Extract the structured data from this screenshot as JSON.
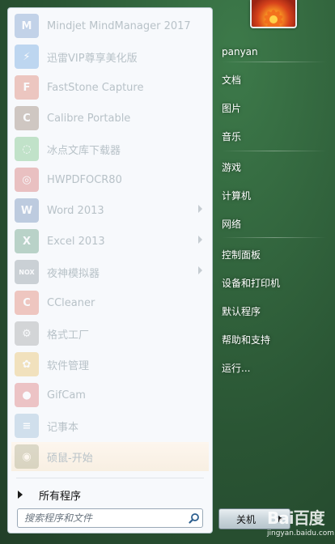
{
  "programs": [
    {
      "label": "Mindjet MindManager 2017",
      "icon": "mindmanager-icon",
      "color": "#3b6fb6",
      "glyph": "M",
      "submenu": false
    },
    {
      "label": "迅雷VIP尊享美化版",
      "icon": "thunder-icon",
      "color": "#2a7fd4",
      "glyph": "⚡",
      "submenu": false
    },
    {
      "label": "FastStone Capture",
      "icon": "faststone-icon",
      "color": "#d2452a",
      "glyph": "F",
      "submenu": false
    },
    {
      "label": "Calibre Portable",
      "icon": "calibre-icon",
      "color": "#6b4a2e",
      "glyph": "C",
      "submenu": false
    },
    {
      "label": "冰点文库下载器",
      "icon": "bingdian-icon",
      "color": "#3aa84a",
      "glyph": "◌",
      "submenu": false
    },
    {
      "label": "HWPDFOCR80",
      "icon": "hwpdfocr-icon",
      "color": "#c8302c",
      "glyph": "◎",
      "submenu": false
    },
    {
      "label": "Word 2013",
      "icon": "word-icon",
      "color": "#2b5797",
      "glyph": "W",
      "submenu": true
    },
    {
      "label": "Excel 2013",
      "icon": "excel-icon",
      "color": "#1e7145",
      "glyph": "X",
      "submenu": true
    },
    {
      "label": "夜神模拟器",
      "icon": "nox-icon",
      "color": "#5a6a74",
      "glyph": "NOX",
      "submenu": true
    },
    {
      "label": "CCleaner",
      "icon": "ccleaner-icon",
      "color": "#d8452a",
      "glyph": "C",
      "submenu": false
    },
    {
      "label": "格式工厂",
      "icon": "format-factory-icon",
      "color": "#7a7a7a",
      "glyph": "⚙",
      "submenu": false
    },
    {
      "label": "软件管理",
      "icon": "software-manager-icon",
      "color": "#e2a41f",
      "glyph": "✿",
      "submenu": false
    },
    {
      "label": "GifCam",
      "icon": "gifcam-icon",
      "color": "#d23a3a",
      "glyph": "●",
      "submenu": false
    },
    {
      "label": "记事本",
      "icon": "notepad-icon",
      "color": "#6f9fc6",
      "glyph": "≡",
      "submenu": false
    },
    {
      "label": "硕鼠-开始",
      "icon": "shushu-icon",
      "color": "#8a8f6a",
      "glyph": "◉",
      "submenu": false
    }
  ],
  "all_programs_label": "所有程序",
  "search": {
    "placeholder": "搜索程序和文件"
  },
  "right_items": [
    {
      "label": "panyan",
      "name": "user-name-link"
    },
    {
      "label": "文档",
      "name": "documents-link"
    },
    {
      "label": "图片",
      "name": "pictures-link"
    },
    {
      "label": "音乐",
      "name": "music-link"
    },
    {
      "label": "游戏",
      "name": "games-link"
    },
    {
      "label": "计算机",
      "name": "computer-link"
    },
    {
      "label": "网络",
      "name": "network-link"
    },
    {
      "label": "控制面板",
      "name": "control-panel-link"
    },
    {
      "label": "设备和打印机",
      "name": "devices-printers-link"
    },
    {
      "label": "默认程序",
      "name": "default-programs-link"
    },
    {
      "label": "帮助和支持",
      "name": "help-support-link"
    },
    {
      "label": "运行...",
      "name": "run-link"
    }
  ],
  "shutdown_label": "关机",
  "watermark": {
    "main": "Bai百度",
    "sub": "jingyan.baidu.com"
  },
  "colors": {
    "pane_bg": "#f7f9fc",
    "right_bg": "#2a5534",
    "text_right": "#ffffff"
  }
}
